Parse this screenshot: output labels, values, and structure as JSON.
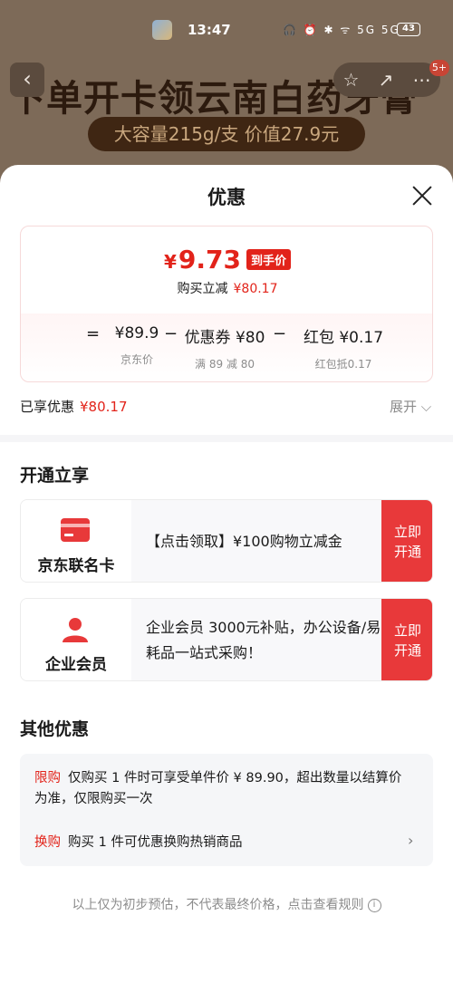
{
  "status_bar": {
    "time": "13:47",
    "system_icons": "🎧 ⏰ ✱ ᯤ 5G 5G",
    "battery": "43"
  },
  "background": {
    "banner_title": "下单开卡领云南白药牙膏",
    "banner_pill": "大容量215g/支  价值27.9元",
    "cart_badge": "5+"
  },
  "sheet": {
    "title": "优惠",
    "price_card": {
      "final_yen": "¥",
      "final_price": "9.73",
      "final_tag": "到手价",
      "discount_label": "购买立减",
      "discount_amount": "¥80.17",
      "calc": {
        "eq": "=",
        "minus": "−",
        "base_value": "¥89.9",
        "base_label": "京东价",
        "coupon_value": "优惠券 ¥80",
        "coupon_label": "满 89 减 80",
        "redpack_value": "红包 ¥0.17",
        "redpack_label": "红包抵0.17"
      }
    },
    "enjoyed_label": "已享优惠",
    "enjoyed_amount": "¥80.17",
    "expand_label": "展开 ⌵",
    "open_section": {
      "title": "开通立享",
      "cards": [
        {
          "name": "京东联名卡",
          "icon": "credit-card-icon",
          "desc": "【点击领取】¥100购物立减金",
          "button": "立即\n开通"
        },
        {
          "name": "企业会员",
          "icon": "person-icon",
          "desc": "企业会员 3000元补贴，办公设备/易耗品一站式采购！",
          "button": "立即\n开通"
        }
      ]
    },
    "other_section": {
      "title": "其他优惠",
      "items": [
        {
          "tag": "限购",
          "text": "仅购买 1 件时可享受单件价 ¥ 89.90，超出数量以结算价为准，仅限购买一次"
        },
        {
          "tag": "换购",
          "text": "购买 1 件可优惠换购热销商品"
        }
      ]
    },
    "footer_note": "以上仅为初步预估，不代表最终价格，点击查看规则",
    "colors": {
      "accent_red": "#e2231a",
      "button_red": "#e8393a"
    }
  }
}
